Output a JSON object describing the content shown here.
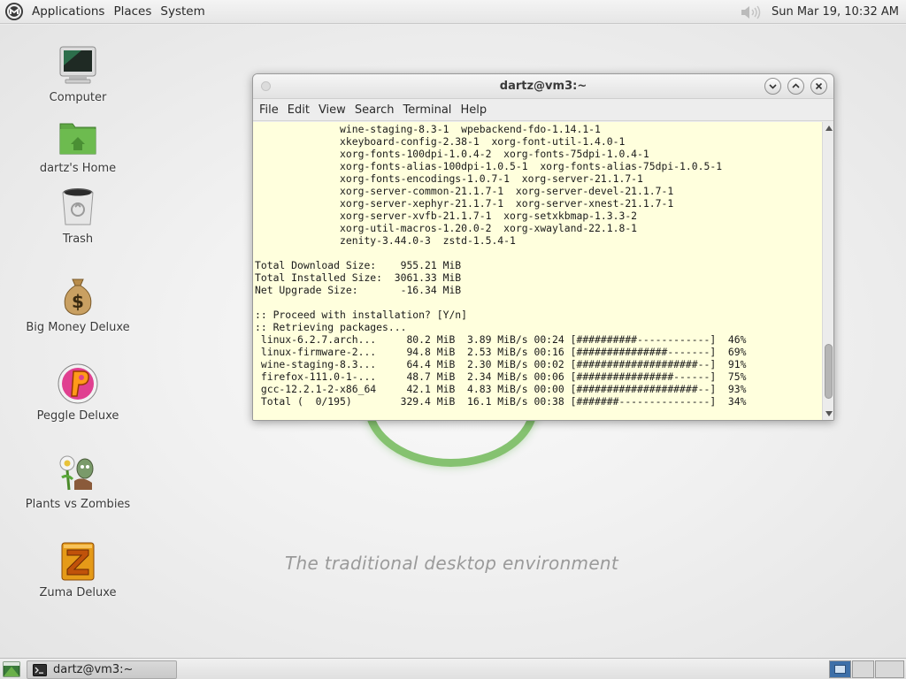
{
  "top_panel": {
    "menus": [
      "Applications",
      "Places",
      "System"
    ],
    "clock": "Sun Mar 19, 10:32 AM"
  },
  "desktop": {
    "tagline": "The traditional desktop environment",
    "icons": [
      {
        "label": "Computer",
        "icon": "computer-icon"
      },
      {
        "label": "dartz's Home",
        "icon": "home-folder-icon"
      },
      {
        "label": "Trash",
        "icon": "trash-icon"
      },
      {
        "label": "Big Money Deluxe",
        "icon": "money-bag-icon"
      },
      {
        "label": "Peggle Deluxe",
        "icon": "peggle-icon"
      },
      {
        "label": "Plants vs Zombies",
        "icon": "plants-vs-zombies-icon"
      },
      {
        "label": "Zuma Deluxe",
        "icon": "zuma-icon"
      }
    ]
  },
  "terminal": {
    "title": "dartz@vm3:~",
    "menus": [
      "File",
      "Edit",
      "View",
      "Search",
      "Terminal",
      "Help"
    ],
    "background_color": "#ffffdd",
    "lines": [
      "              wine-staging-8.3-1  wpebackend-fdo-1.14.1-1",
      "              xkeyboard-config-2.38-1  xorg-font-util-1.4.0-1",
      "              xorg-fonts-100dpi-1.0.4-2  xorg-fonts-75dpi-1.0.4-1",
      "              xorg-fonts-alias-100dpi-1.0.5-1  xorg-fonts-alias-75dpi-1.0.5-1",
      "              xorg-fonts-encodings-1.0.7-1  xorg-server-21.1.7-1",
      "              xorg-server-common-21.1.7-1  xorg-server-devel-21.1.7-1",
      "              xorg-server-xephyr-21.1.7-1  xorg-server-xnest-21.1.7-1",
      "              xorg-server-xvfb-21.1.7-1  xorg-setxkbmap-1.3.3-2",
      "              xorg-util-macros-1.20.0-2  xorg-xwayland-22.1.8-1",
      "              zenity-3.44.0-3  zstd-1.5.4-1",
      "",
      "Total Download Size:    955.21 MiB",
      "Total Installed Size:  3061.33 MiB",
      "Net Upgrade Size:       -16.34 MiB",
      "",
      ":: Proceed with installation? [Y/n]",
      ":: Retrieving packages...",
      " linux-6.2.7.arch...     80.2 MiB  3.89 MiB/s 00:24 [##########------------]  46%",
      " linux-firmware-2...     94.8 MiB  2.53 MiB/s 00:16 [###############-------]  69%",
      " wine-staging-8.3...     64.4 MiB  2.30 MiB/s 00:02 [####################--]  91%",
      " firefox-111.0-1-...     48.7 MiB  2.34 MiB/s 00:06 [################------]  75%",
      " gcc-12.2.1-2-x86_64     42.1 MiB  4.83 MiB/s 00:00 [####################--]  93%",
      " Total (  0/195)        329.4 MiB  16.1 MiB/s 00:38 [#######---------------]  34%"
    ]
  },
  "bottom_panel": {
    "task_label": "dartz@vm3:~"
  }
}
